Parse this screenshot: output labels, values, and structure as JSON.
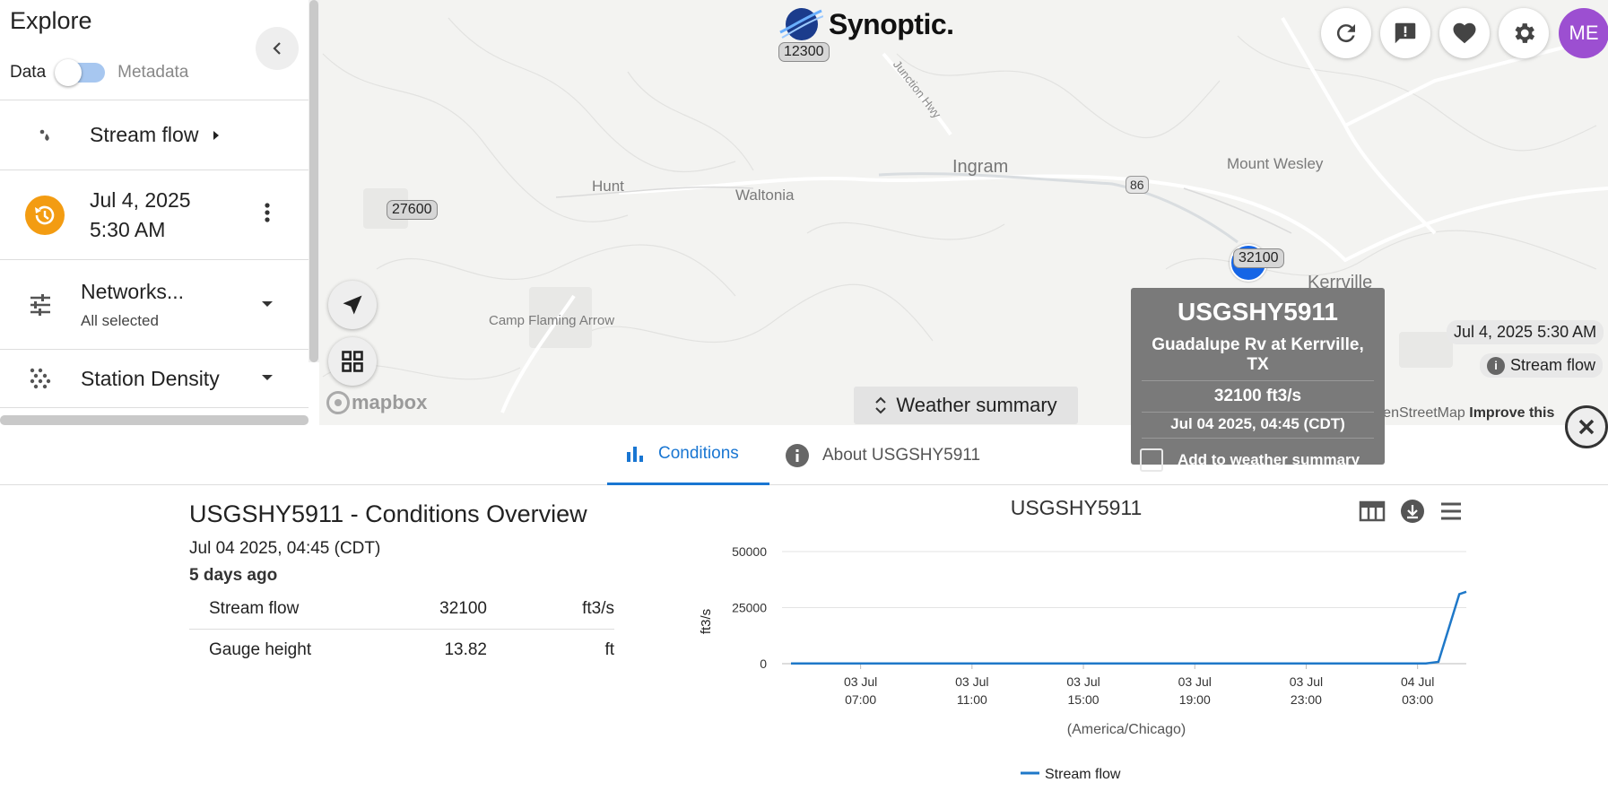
{
  "sidebar": {
    "title": "Explore",
    "toggle": {
      "left_label": "Data",
      "right_label": "Metadata"
    },
    "variable": {
      "label": "Stream flow"
    },
    "time": {
      "date": "Jul 4, 2025",
      "clock": "5:30 AM"
    },
    "networks": {
      "label": "Networks...",
      "sub": "All selected"
    },
    "density": {
      "label": "Station Density"
    }
  },
  "map": {
    "logo_text": "Synoptic.",
    "places": [
      "Ingram",
      "Hunt",
      "Waltonia",
      "Mount Wesley",
      "Kerrville",
      "Camp Flaming Arrow"
    ],
    "road_label": "Junction Hwy",
    "route_shield": "86",
    "station_labels": [
      "12300",
      "27600",
      "32100"
    ],
    "date_chip": "Jul 4, 2025 5:30 AM",
    "variable_chip": "Stream flow",
    "weather_summary_label": "Weather summary",
    "mapbox_text": "mapbox",
    "attribution": {
      "text": "© Mapbox © OpenStreetMap",
      "improve": "Improve this"
    },
    "avatar_initials": "ME"
  },
  "popup": {
    "station_id": "USGSHY5911",
    "name": "Guadalupe Rv at Kerrville, TX",
    "value": "32100 ft3/s",
    "time": "Jul 04 2025, 04:45 (CDT)",
    "add_label": "Add to weather summary"
  },
  "tabs": [
    {
      "label": "Conditions",
      "active": true
    },
    {
      "label": "About USGSHY5911",
      "active": false
    }
  ],
  "conditions": {
    "title": "USGSHY5911 - Conditions Overview",
    "time": "Jul 04 2025, 04:45 (CDT)",
    "ago": "5 days ago",
    "rows": [
      {
        "name": "Stream flow",
        "value": "32100",
        "unit": "ft3/s"
      },
      {
        "name": "Gauge height",
        "value": "13.82",
        "unit": "ft"
      }
    ]
  },
  "colors": {
    "accent": "#1976d2",
    "series": "#1f78c8",
    "station": "#1565e6",
    "history": "#f39c12",
    "avatar": "#9c4fd1"
  },
  "chart_data": {
    "type": "line",
    "title": "USGSHY5911",
    "ylabel": "ft3/s",
    "xlabel": "(America/Chicago)",
    "ylim": [
      0,
      50000
    ],
    "yticks": [
      0,
      25000,
      50000
    ],
    "xticks": [
      {
        "date": "03 Jul",
        "time": "07:00",
        "hour": 7
      },
      {
        "date": "03 Jul",
        "time": "11:00",
        "hour": 11
      },
      {
        "date": "03 Jul",
        "time": "15:00",
        "hour": 15
      },
      {
        "date": "03 Jul",
        "time": "19:00",
        "hour": 19
      },
      {
        "date": "03 Jul",
        "time": "23:00",
        "hour": 23
      },
      {
        "date": "04 Jul",
        "time": "03:00",
        "hour": 27
      }
    ],
    "xrange": [
      4.5,
      28.75
    ],
    "series": [
      {
        "name": "Stream flow",
        "points": [
          [
            4.5,
            80
          ],
          [
            10,
            80
          ],
          [
            15,
            80
          ],
          [
            20,
            80
          ],
          [
            25,
            80
          ],
          [
            27.3,
            120
          ],
          [
            27.75,
            800
          ],
          [
            28.5,
            31000
          ],
          [
            28.75,
            32100
          ]
        ]
      }
    ],
    "legend_position": "bottom-center",
    "grid": true
  }
}
